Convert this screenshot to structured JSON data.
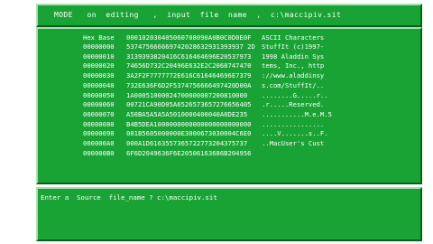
{
  "status_line": "MODE   on  editing   ,  input  file  name  ,  c:\\maccipiv.sit",
  "hex_view": {
    "offset_header": "Hex Base",
    "hex_header": "000102030405060708090A0B0C0D0E0F",
    "ascii_header": "ASCII Characters",
    "rows": [
      {
        "offset": "00000000",
        "hex": "537475666669742028632931393937 2D",
        "ascii": "StuffIt (c)1997-"
      },
      {
        "offset": "00000010",
        "hex": "3139393820416C616464696E20537973",
        "ascii": "1998 Aladdin Sys"
      },
      {
        "offset": "00000020",
        "hex": "74656D732C20496E632E2C2068747470",
        "ascii": "tems, Inc., http"
      },
      {
        "offset": "00000030",
        "hex": "3A2F2F7777772E616C616464696E7379",
        "ascii": "://www.aladdinsy"
      },
      {
        "offset": "00000040",
        "hex": "732E636F6D2F5374756666497420D00A",
        "ascii": "s.com/StuffIt/.."
      },
      {
        "offset": "00000050",
        "hex": "1A00051000024700000007200810000",
        "ascii": "........G.....r.."
      },
      {
        "offset": "00000060",
        "hex": "00721CA90D05A6526573657276656405",
        "ascii": ".r.....Reserved."
      },
      {
        "offset": "00000070",
        "hex": "A50BA5A5A5A5010000400040A0DE235",
        "ascii": "...........M.e.M.5"
      },
      {
        "offset": "00000080",
        "hex": "B4B5DEA1000000000000000000000000",
        "ascii": "................"
      },
      {
        "offset": "00000090",
        "hex": "001B5605000000E3000673030004C6E0",
        "ascii": "....V.......s..F."
      },
      {
        "offset": "000000A0",
        "hex": "000A1D6163557365722773204375737",
        "ascii": "..MacUser's Cust"
      },
      {
        "offset": "000000B0",
        "hex": "6F6D2049636F6E20506163686B204956",
        "ascii": ""
      }
    ]
  },
  "prompt_line": "Enter a  Source  file_name ? c:\\maccipiv.sit"
}
